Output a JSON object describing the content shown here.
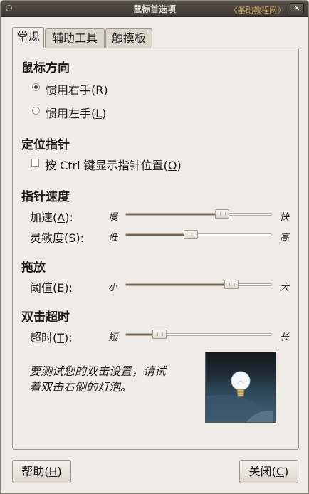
{
  "window": {
    "title": "鼠标首选项",
    "watermark": "《基础教程网》",
    "close_glyph": "✕"
  },
  "tabs": [
    {
      "label": "常规"
    },
    {
      "label": "辅助工具"
    },
    {
      "label": "触摸板"
    }
  ],
  "orientation": {
    "heading": "鼠标方向",
    "right": "惯用右手(",
    "right_key": "R",
    "left": "惯用左手(",
    "left_key": "L",
    "close_paren": ")",
    "selected": "right"
  },
  "locate": {
    "heading": "定位指针",
    "label": "按 Ctrl 键显示指针位置(",
    "key": "O",
    "close_paren": ")",
    "checked": false
  },
  "speed": {
    "heading": "指针速度",
    "accel": {
      "label": "加速(",
      "key": "A",
      "suffix": "):",
      "min": "慢",
      "max": "快",
      "value": 0.68
    },
    "sens": {
      "label": "灵敏度(",
      "key": "S",
      "suffix": "):",
      "min": "低",
      "max": "高",
      "value": 0.44
    }
  },
  "drag": {
    "heading": "拖放",
    "threshold": {
      "label": "阈值(",
      "key": "E",
      "suffix": "):",
      "min": "小",
      "max": "大",
      "value": 0.75
    }
  },
  "dbl": {
    "heading": "双击超时",
    "timeout": {
      "label": "超时(",
      "key": "T",
      "suffix": "):",
      "min": "短",
      "max": "长",
      "value": 0.2
    },
    "hint": "要测试您的双击设置，请试着双击右侧的灯泡。"
  },
  "buttons": {
    "help": "帮助(",
    "help_key": "H",
    "close": "关闭(",
    "close_key": "C",
    "close_paren": ")"
  }
}
